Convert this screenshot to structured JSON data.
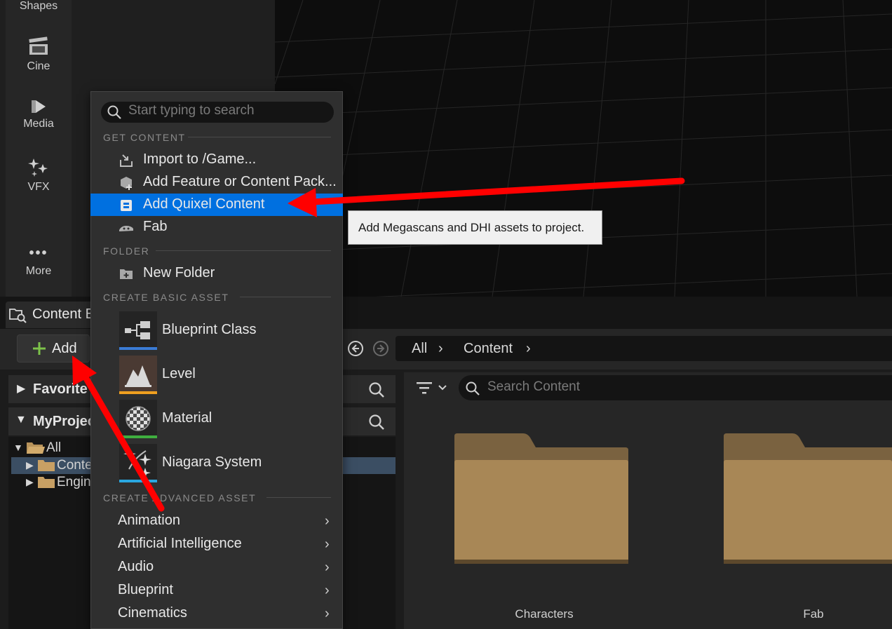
{
  "place_actors": {
    "items": [
      {
        "label": "Shapes",
        "icon": "shapes-icon"
      },
      {
        "label": "Cine",
        "icon": "clapperboard-icon"
      },
      {
        "label": "Media",
        "icon": "media-icon"
      },
      {
        "label": "VFX",
        "icon": "sparkles-icon"
      },
      {
        "label": "More",
        "icon": "ellipsis-icon"
      }
    ]
  },
  "content_browser": {
    "tab_label": "Content B",
    "add_label": "Add",
    "breadcrumb": [
      "All",
      "Content"
    ],
    "search_placeholder": "Search Content",
    "favorites_label": "Favorite",
    "project_label": "MyProjec",
    "tree": [
      {
        "label": "All"
      },
      {
        "label": "Conte"
      },
      {
        "label": "Engin"
      }
    ],
    "folders": [
      {
        "label": "Characters"
      },
      {
        "label": "Fab"
      }
    ]
  },
  "menu": {
    "search_placeholder": "Start typing to search",
    "sections": {
      "get_content": "GET CONTENT",
      "folder": "FOLDER",
      "basic": "CREATE BASIC ASSET",
      "advanced": "CREATE ADVANCED ASSET"
    },
    "get_content_items": [
      {
        "label": "Import to /Game..."
      },
      {
        "label": "Add Feature or Content Pack..."
      },
      {
        "label": "Add Quixel Content"
      },
      {
        "label": "Fab"
      }
    ],
    "folder_items": [
      {
        "label": "New Folder"
      }
    ],
    "basic_assets": [
      {
        "label": "Blueprint Class",
        "color": "#3a7bd5"
      },
      {
        "label": "Level",
        "color": "#f0a020"
      },
      {
        "label": "Material",
        "color": "#3fae3f"
      },
      {
        "label": "Niagara System",
        "color": "#2aa7e0"
      }
    ],
    "advanced_items": [
      {
        "label": "Animation"
      },
      {
        "label": "Artificial Intelligence"
      },
      {
        "label": "Audio"
      },
      {
        "label": "Blueprint"
      },
      {
        "label": "Cinematics"
      }
    ]
  },
  "tooltip": {
    "text": "Add Megascans and DHI assets to project."
  },
  "colors": {
    "accent": "#0070e0",
    "annotation": "#ff0000",
    "folder": "#b8935a"
  }
}
